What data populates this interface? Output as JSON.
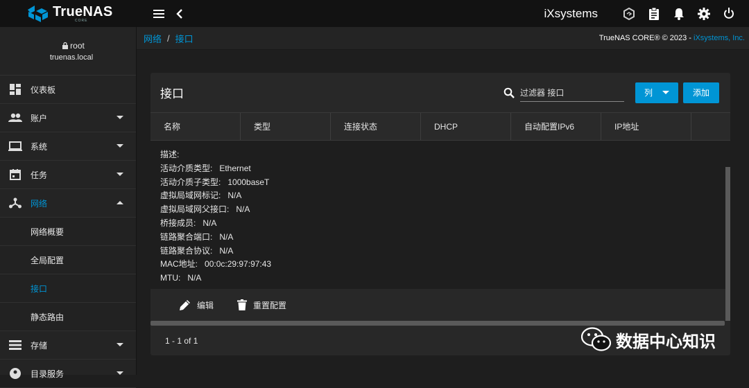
{
  "app": {
    "name": "TrueNAS",
    "edition": "CORE",
    "vendor": "iXsystems"
  },
  "topbar": {
    "vendor_logo": "iXsystems"
  },
  "user": {
    "name": "root",
    "host": "truenas.local"
  },
  "sidebar": {
    "items": [
      {
        "label": "仪表板",
        "icon": "dashboard-icon"
      },
      {
        "label": "账户",
        "icon": "accounts-icon"
      },
      {
        "label": "系统",
        "icon": "laptop-icon"
      },
      {
        "label": "任务",
        "icon": "calendar-icon"
      },
      {
        "label": "网络",
        "icon": "network-icon"
      },
      {
        "label": "存储",
        "icon": "storage-icon"
      },
      {
        "label": "目录服务",
        "icon": "directory-icon"
      }
    ],
    "network_sub": [
      "网络概要",
      "全局配置",
      "接口",
      "静态路由"
    ]
  },
  "breadcrumb": {
    "first": "网络",
    "second": "接口"
  },
  "copyright": {
    "text": "TrueNAS CORE® © 2023 - ",
    "link": "iXsystems, Inc."
  },
  "card": {
    "title": "接口",
    "filter_placeholder": "过滤器 接口",
    "columns_button": "列",
    "add_button": "添加",
    "headers": [
      "名称",
      "类型",
      "连接状态",
      "DHCP",
      "自动配置IPv6",
      "IP地址"
    ]
  },
  "detail": [
    {
      "label": "描述:",
      "value": ""
    },
    {
      "label": "活动介质类型:",
      "value": "Ethernet"
    },
    {
      "label": "活动介质子类型:",
      "value": "1000baseT"
    },
    {
      "label": "虚拟局域网标记:",
      "value": "N/A"
    },
    {
      "label": "虚拟局域网父接口:",
      "value": "N/A"
    },
    {
      "label": "桥接成员:",
      "value": "N/A"
    },
    {
      "label": "链路聚合端口:",
      "value": "N/A"
    },
    {
      "label": "链路聚合协议:",
      "value": "N/A"
    },
    {
      "label": "MAC地址:",
      "value": "00:0c:29:97:97:43"
    },
    {
      "label": "MTU:",
      "value": "N/A"
    }
  ],
  "actions": {
    "edit": "编辑",
    "reset": "重置配置"
  },
  "pager": "1 - 1 of 1",
  "watermark": "数据中心知识",
  "colors": {
    "accent": "#0095d5",
    "bg": "#1e1e1e",
    "topbar": "#121212"
  }
}
